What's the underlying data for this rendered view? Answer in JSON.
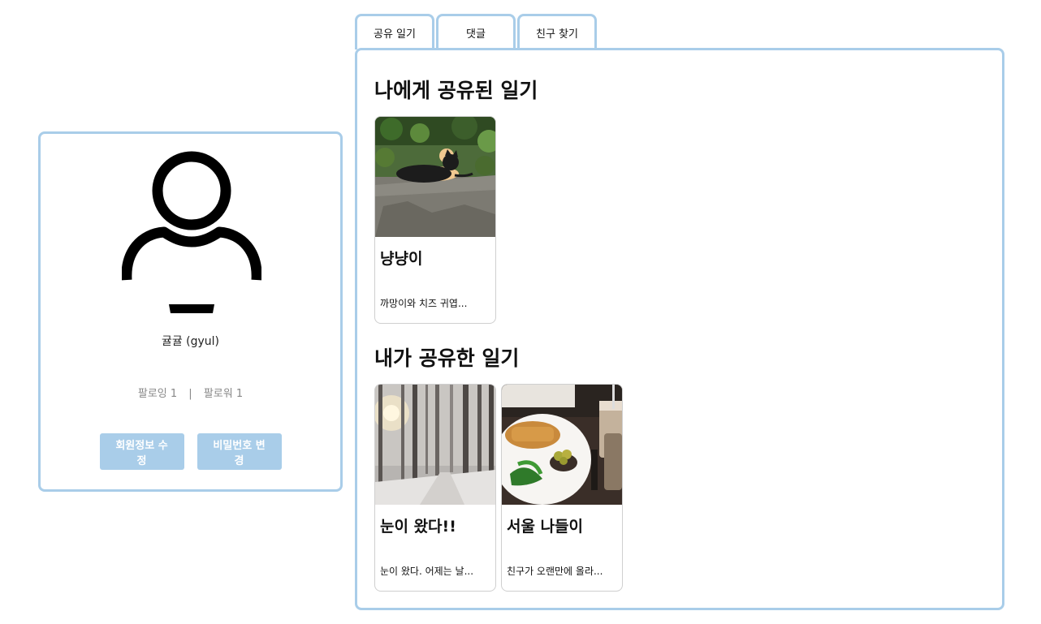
{
  "profile": {
    "name": "귤귤 (gyul)",
    "following_label": "팔로잉 1",
    "separator": "|",
    "follower_label": "팔로워 1",
    "edit_profile_label": "회원정보 수정",
    "change_password_label": "비밀번호 변경"
  },
  "tabs": [
    {
      "label": "공유 일기"
    },
    {
      "label": "댓글"
    },
    {
      "label": "친구 찾기"
    }
  ],
  "sections": {
    "shared_to_me": {
      "title": "나에게 공유된 일기",
      "cards": [
        {
          "title": "냥냥이",
          "excerpt": "까망이와 치즈 귀엽...",
          "thumb": "cats-on-rock-photo"
        }
      ]
    },
    "shared_by_me": {
      "title": "내가 공유한 일기",
      "cards": [
        {
          "title": "눈이 왔다!!",
          "excerpt": "눈이 왔다. 어제는 날...",
          "thumb": "snowy-forest-photo"
        },
        {
          "title": "서울 나들이",
          "excerpt": "친구가 오랜만에 올라...",
          "thumb": "cafe-meal-photo"
        }
      ]
    }
  },
  "colors": {
    "border_accent": "#a9cde9",
    "button_bg": "#a9cde9",
    "button_text": "#ffffff",
    "muted_text": "#888888"
  },
  "icons": {
    "avatar": "user-avatar-icon"
  }
}
